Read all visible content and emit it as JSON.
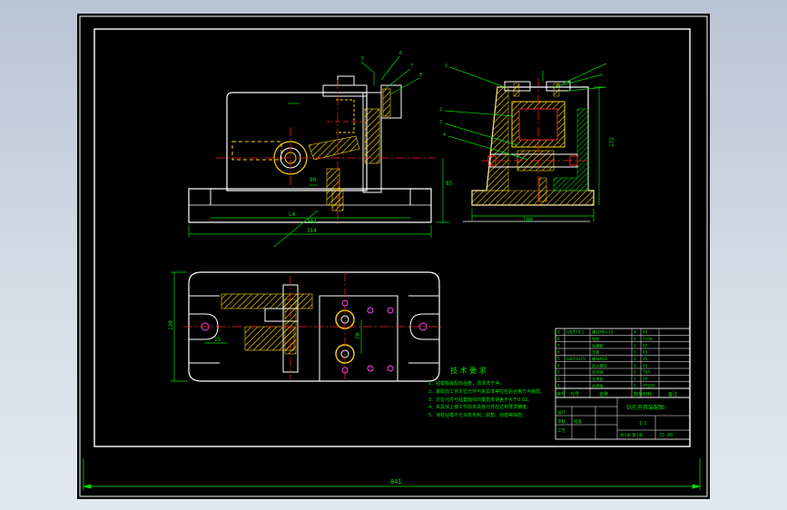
{
  "drawing": {
    "overall_width_dim": "841",
    "front_view": {
      "dim_width_a": "284",
      "dim_width_b": "314",
      "dim_inner": "L4",
      "dim_height": "85",
      "dim_center": "90",
      "leader_numbers": [
        "5",
        "6",
        "7",
        "8"
      ]
    },
    "side_view": {
      "dim_width": "180",
      "dim_height": "172",
      "leader_numbers": [
        "1",
        "2",
        "3",
        "4"
      ]
    },
    "top_view": {
      "dim_height": "130",
      "dim_c": "70",
      "dim_d": "15"
    }
  },
  "tech_requirements": {
    "title": "技 术 要 求",
    "items": [
      "1、钻模板装配前检查，须清洗干净。",
      "2、装配前工件定位元件与夹具体等应检验合格方可装配。",
      "3、定位元件与钻套轴线的垂直度误差不大于0.02。",
      "4、夹具体上装工件前夹具各元件应达到要求精度。",
      "5、滑柱钻模不允许有毛刺、锐角、划痕等缺陷。"
    ]
  },
  "parts_table": {
    "header": [
      "序号",
      "代号",
      "名称",
      "数量",
      "材料",
      "备注"
    ],
    "rows": [
      [
        "9",
        "GB/T70.1",
        "螺钉M8×25",
        "4",
        "45"
      ],
      [
        "8",
        "",
        "钻套",
        "1",
        "T10A"
      ],
      [
        "7",
        "",
        "钻模板",
        "1",
        "45"
      ],
      [
        "6",
        "",
        "压板",
        "1",
        "45"
      ],
      [
        "5",
        "GB/T6170",
        "螺母M12",
        "2",
        "35"
      ],
      [
        "4",
        "",
        "双头螺柱",
        "1",
        "45"
      ],
      [
        "3",
        "",
        "定位销",
        "1",
        "T8A"
      ],
      [
        "2",
        "",
        "支承板",
        "1",
        "20"
      ],
      [
        "1",
        "",
        "夹具体",
        "1",
        "HT200"
      ]
    ]
  },
  "title_block": {
    "drawing_title": "钻孔夹具装配图",
    "scale": "1:1",
    "drawing_no": "JJ-00",
    "design_label": "设计",
    "check_label": "审核",
    "process_label": "工艺",
    "approve_label": "批准",
    "sheet_label": "共1张 第1张"
  },
  "colors": {
    "background": "#000000",
    "border": "#ffffff",
    "part": "#ffffff",
    "dimension": "#00ff00",
    "centerline": "#ff0000",
    "hatch": "#ffff00",
    "leader": "#00ff00",
    "hole": "#ff00ff",
    "table_text": "#00ff00"
  }
}
